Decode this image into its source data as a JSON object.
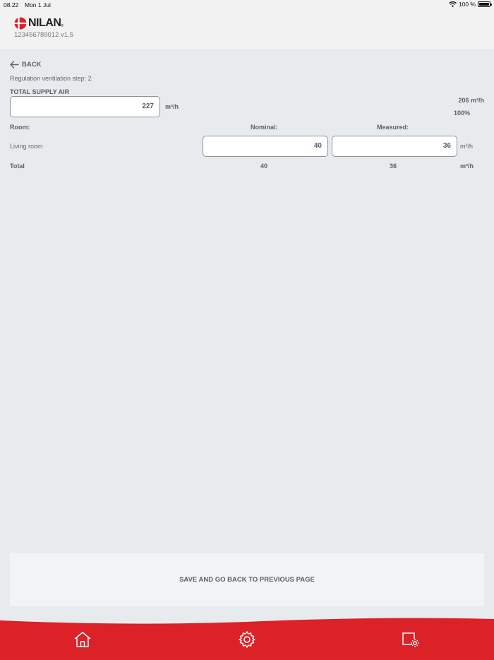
{
  "status_bar": {
    "time": "08.22",
    "date": "Mon 1 Jul",
    "battery": "100 %",
    "battery_level": 1.0
  },
  "header": {
    "brand": "NILAN",
    "brand_mark": "®",
    "serial": "123456789012 v1.5"
  },
  "nav": {
    "back_label": "BACK"
  },
  "regulation": {
    "step_text": "Regulation ventilation step: 2",
    "title": "TOTAL SUPPLY AIR",
    "total_value": "227",
    "total_unit": "m³/h",
    "actual_flow": "206 m³/h",
    "actual_percent": "100%"
  },
  "table": {
    "col_room": "Room:",
    "col_nominal": "Nominal:",
    "col_measured": "Measured:",
    "rows": [
      {
        "room": "Living room",
        "nominal": "40",
        "measured": "36",
        "unit": "m³/h"
      }
    ],
    "total": {
      "label": "Total",
      "nominal": "40",
      "measured": "36",
      "unit": "m³/h"
    }
  },
  "actions": {
    "save_label": "SAVE AND GO BACK TO PREVIOUS PAGE"
  },
  "footer": {
    "icons": [
      "home-icon",
      "gear-icon",
      "device-settings-icon"
    ]
  },
  "colors": {
    "accent_red": "#dc2127",
    "background": "#e8ebee",
    "header_bg": "#f2f2f2"
  }
}
